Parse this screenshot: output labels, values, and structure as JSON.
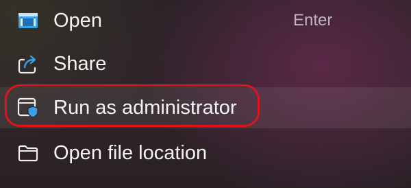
{
  "context_menu": {
    "items": [
      {
        "label": "Open",
        "shortcut": "Enter",
        "icon": "open-app-icon"
      },
      {
        "label": "Share",
        "icon": "share-icon"
      },
      {
        "label": "Run as administrator",
        "icon": "shield-window-icon",
        "highlighted": true
      },
      {
        "label": "Open file location",
        "icon": "folder-icon"
      }
    ]
  },
  "colors": {
    "highlight_ring": "#e3121c",
    "text": "#f4f4f4",
    "shortcut_text": "#bdb5ba",
    "accent_blue": "#3aa0e8"
  }
}
